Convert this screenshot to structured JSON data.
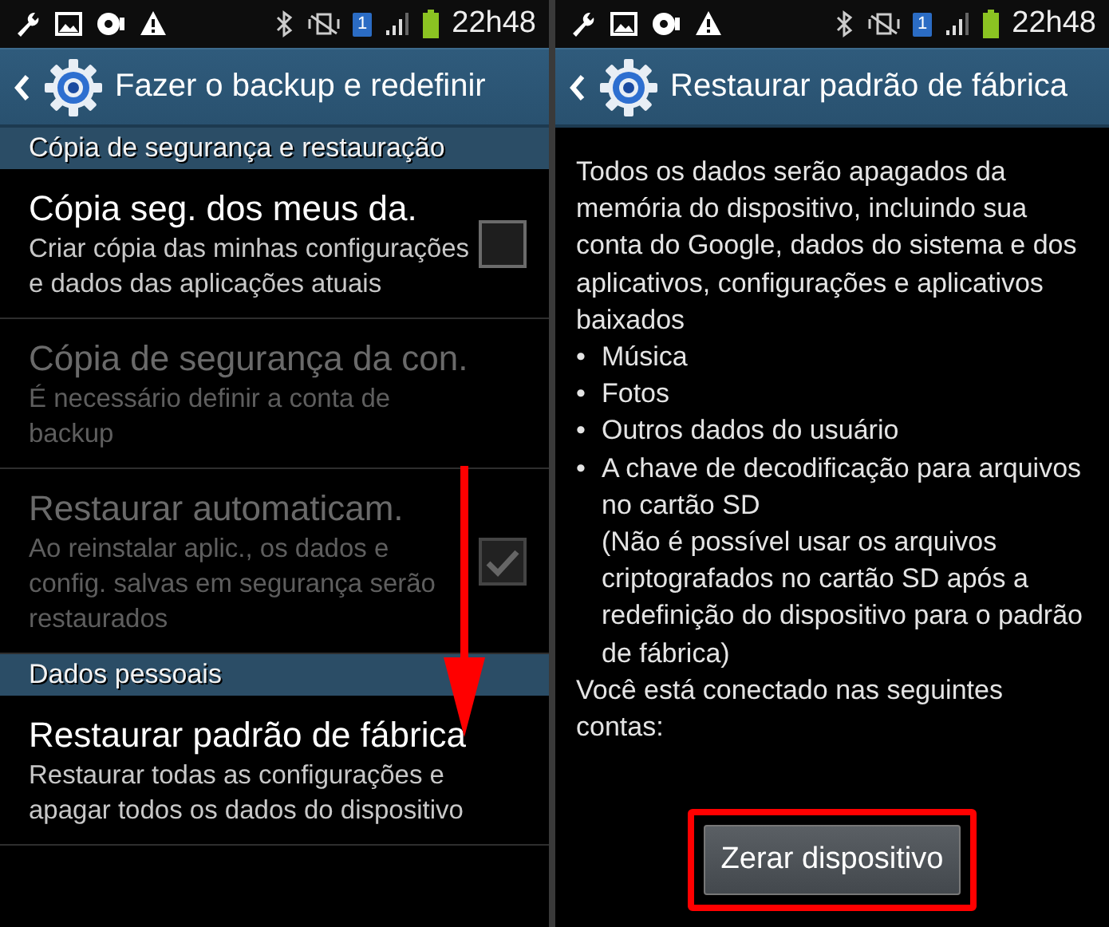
{
  "screens": [
    {
      "kind": "settings",
      "status_bar": {
        "sim_badge": "1",
        "time": "22h48"
      },
      "action_bar": {
        "title": "Fazer o backup e redefinir"
      },
      "sections": [
        {
          "header": "Cópia de segurança e restauração",
          "items": [
            {
              "kind": "checkbox",
              "title": "Cópia seg. dos meus da.",
              "summary": "Criar cópia das minhas configurações e dados das aplicações atuais",
              "disabled": false,
              "checked": false
            },
            {
              "kind": "plain",
              "title": "Cópia de segurança da con.",
              "summary": "É necessário definir a conta de backup",
              "disabled": true
            },
            {
              "kind": "checkbox",
              "title": "Restaurar automaticam.",
              "summary": "Ao reinstalar aplic., os dados e config. salvas em segurança serão restaurados",
              "disabled": true,
              "checked": true
            }
          ]
        },
        {
          "header": "Dados pessoais",
          "items": [
            {
              "kind": "plain",
              "title": "Restaurar padrão de fábrica",
              "summary": "Restaurar todas as configurações e apagar todos os dados do dispositivo",
              "disabled": false
            }
          ]
        }
      ]
    },
    {
      "kind": "confirm",
      "status_bar": {
        "sim_badge": "1",
        "time": "22h48"
      },
      "action_bar": {
        "title": "Restaurar padrão de fábrica"
      },
      "intro": "Todos os dados serão apagados da memória do dispositivo, incluindo sua conta do Google, dados do sistema e dos aplicativos, configurações e aplicativos baixados",
      "bullets": [
        {
          "marker": "•",
          "paragraphs": [
            "Música"
          ]
        },
        {
          "marker": "•",
          "paragraphs": [
            "Fotos"
          ]
        },
        {
          "marker": "•",
          "paragraphs": [
            "Outros dados do usuário"
          ]
        },
        {
          "marker": "•",
          "paragraphs": [
            "A chave de decodificação para arquivos no cartão SD",
            "(Não é possível usar os arquivos criptografados no cartão SD após a redefinição do dispositivo para o padrão de fábrica)"
          ]
        }
      ],
      "accounts_note": "Você está conectado nas seguintes contas:",
      "button": {
        "label": "Zerar dispositivo",
        "highlighted": true
      }
    }
  ]
}
